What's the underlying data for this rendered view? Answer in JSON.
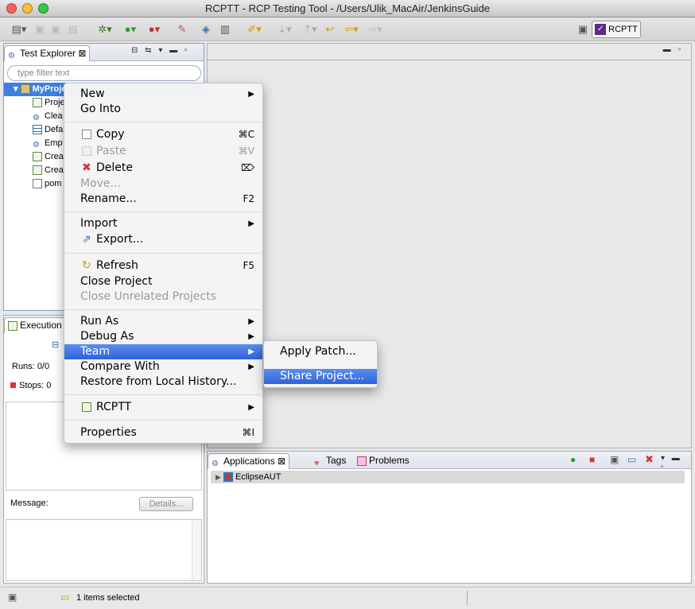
{
  "window": {
    "title": "RCPTT - RCP Testing Tool - /Users/Ulik_MacAir/JenkinsGuide",
    "close_color": "#fc605c",
    "minimize_color": "#fdbc40",
    "zoom_color": "#34c84a"
  },
  "perspective": {
    "label": "RCPTT"
  },
  "test_explorer": {
    "tab_label": "Test Explorer",
    "filter_placeholder": "type filter text",
    "items": [
      {
        "label": "MyProje",
        "icon": "project-folder-icon"
      },
      {
        "label": "Proje",
        "icon": "project-settings-icon"
      },
      {
        "label": "Clea",
        "icon": "context-icon"
      },
      {
        "label": "Defa",
        "icon": "table-icon"
      },
      {
        "label": "Emp",
        "icon": "context-icon"
      },
      {
        "label": "Crea",
        "icon": "test-case-icon"
      },
      {
        "label": "Crea",
        "icon": "test-case-icon"
      },
      {
        "label": "pom",
        "icon": "file-icon"
      }
    ]
  },
  "execution": {
    "tab_label": "Execution",
    "runs_label": "Runs:",
    "runs_value": "0/0",
    "stops_label": "Stops:",
    "stops_value": "0",
    "message_label": "Message:",
    "details_button": "Details..."
  },
  "bottom_panel": {
    "tabs": [
      {
        "label": "Applications",
        "icon": "applications-icon"
      },
      {
        "label": "Tags",
        "icon": "tag-icon"
      },
      {
        "label": "Problems",
        "icon": "problems-icon"
      }
    ],
    "aut_item": "EclipseAUT"
  },
  "status": {
    "selection": "1 items selected"
  },
  "context_menu": {
    "new": "New",
    "go_into": "Go Into",
    "copy": "Copy",
    "copy_sc": "⌘C",
    "paste": "Paste",
    "paste_sc": "⌘V",
    "delete": "Delete",
    "delete_sc": "⌦",
    "move": "Move...",
    "rename": "Rename...",
    "rename_sc": "F2",
    "import": "Import",
    "export": "Export...",
    "refresh": "Refresh",
    "refresh_sc": "F5",
    "close_project": "Close Project",
    "close_unrelated": "Close Unrelated Projects",
    "run_as": "Run As",
    "debug_as": "Debug As",
    "team": "Team",
    "compare_with": "Compare With",
    "restore": "Restore from Local History...",
    "rcptt": "RCPTT",
    "properties": "Properties",
    "properties_sc": "⌘I"
  },
  "team_submenu": {
    "apply_patch": "Apply Patch...",
    "share_project": "Share Project..."
  },
  "colors": {
    "selection_blue": "#3a6fdc",
    "tree_selection": "#3d80df"
  }
}
